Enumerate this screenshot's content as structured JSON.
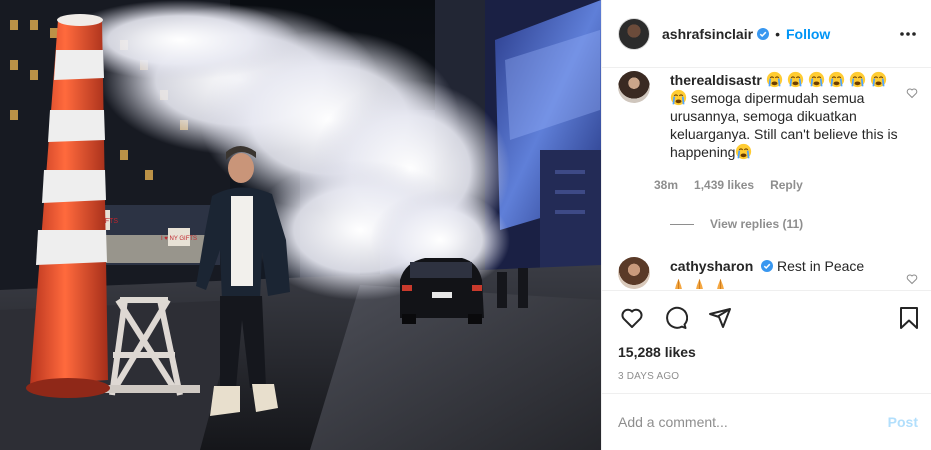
{
  "post": {
    "username": "ashrafsinclair",
    "separator": "•",
    "follow_label": "Follow",
    "likes": "15,288 likes",
    "posted": "3 DAYS AGO"
  },
  "comments": [
    {
      "username": "therealdisastr",
      "text": "semoga dipermudah semua urusannya, semoga dikuatkan keluarganya. Still can't believe this is happening",
      "time": "38m",
      "likes": "1,439 likes",
      "reply_label": "Reply",
      "view_replies": "View replies (11)"
    },
    {
      "username": "cathysharon",
      "text": "Rest in Peace"
    }
  ],
  "photo": {
    "sign_1": "I ♥ NY GIFTS",
    "sign_2": "I ♥ NY GIFTS"
  },
  "composer": {
    "placeholder": "Add a comment...",
    "post_label": "Post"
  },
  "icons": [
    "verified-icon",
    "more-options-icon",
    "heart-icon",
    "comment-icon",
    "share-icon",
    "bookmark-icon",
    "crying-face-icon",
    "praying-hands-icon"
  ],
  "colors": {
    "link_blue": "#0095f6",
    "post_disabled": "#b2dffc",
    "muted": "#8e8e8e",
    "border": "#efefef"
  }
}
